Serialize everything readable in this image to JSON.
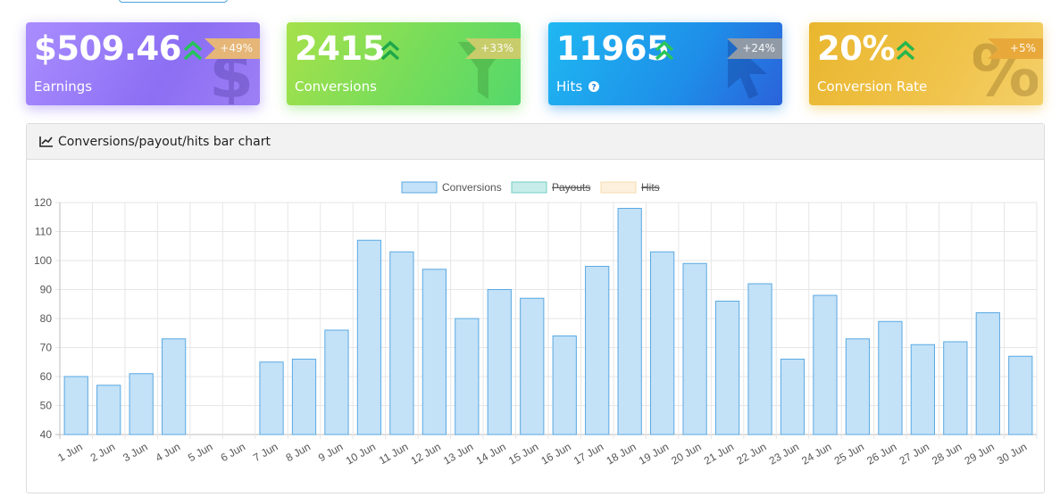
{
  "cards": [
    {
      "value": "$509.46",
      "label": "Earnings",
      "change": "+49%",
      "icon": "dollar-icon"
    },
    {
      "value": "2415",
      "label": "Conversions",
      "change": "+33%",
      "icon": "filter-icon"
    },
    {
      "value": "11965",
      "label": "Hits",
      "change": "+24%",
      "icon": "cursor-icon"
    },
    {
      "value": "20%",
      "label": "Conversion Rate",
      "change": "+5%",
      "icon": "percent-icon"
    }
  ],
  "panel": {
    "title": "Conversions/payout/hits bar chart",
    "icon": "line-chart-icon"
  },
  "chart_data": {
    "type": "bar",
    "categories": [
      "1 Jun",
      "2 Jun",
      "3 Jun",
      "4 Jun",
      "5 Jun",
      "6 Jun",
      "7 Jun",
      "8 Jun",
      "9 Jun",
      "10 Jun",
      "11 Jun",
      "12 Jun",
      "13 Jun",
      "14 Jun",
      "15 Jun",
      "16 Jun",
      "17 Jun",
      "18 Jun",
      "19 Jun",
      "20 Jun",
      "21 Jun",
      "22 Jun",
      "23 Jun",
      "24 Jun",
      "25 Jun",
      "26 Jun",
      "27 Jun",
      "28 Jun",
      "29 Jun",
      "30 Jun"
    ],
    "series": [
      {
        "name": "Conversions",
        "values": [
          60,
          57,
          61,
          73,
          40,
          40,
          65,
          66,
          76,
          107,
          103,
          97,
          80,
          90,
          87,
          74,
          98,
          118,
          103,
          99,
          86,
          92,
          66,
          88,
          73,
          79,
          71,
          72,
          82,
          67
        ],
        "color": "#c3e1f7",
        "border": "#5aa9e3",
        "hidden": false
      },
      {
        "name": "Payouts",
        "values": [],
        "color": "#c7ece9",
        "border": "#6fcfc5",
        "hidden": true
      },
      {
        "name": "Hits",
        "values": [],
        "color": "#fdf0dc",
        "border": "#f7dcae",
        "hidden": true
      }
    ],
    "ylim": [
      40,
      120
    ],
    "yticks": [
      40,
      50,
      60,
      70,
      80,
      90,
      100,
      110,
      120
    ],
    "grid": true,
    "legend": "top-center"
  }
}
